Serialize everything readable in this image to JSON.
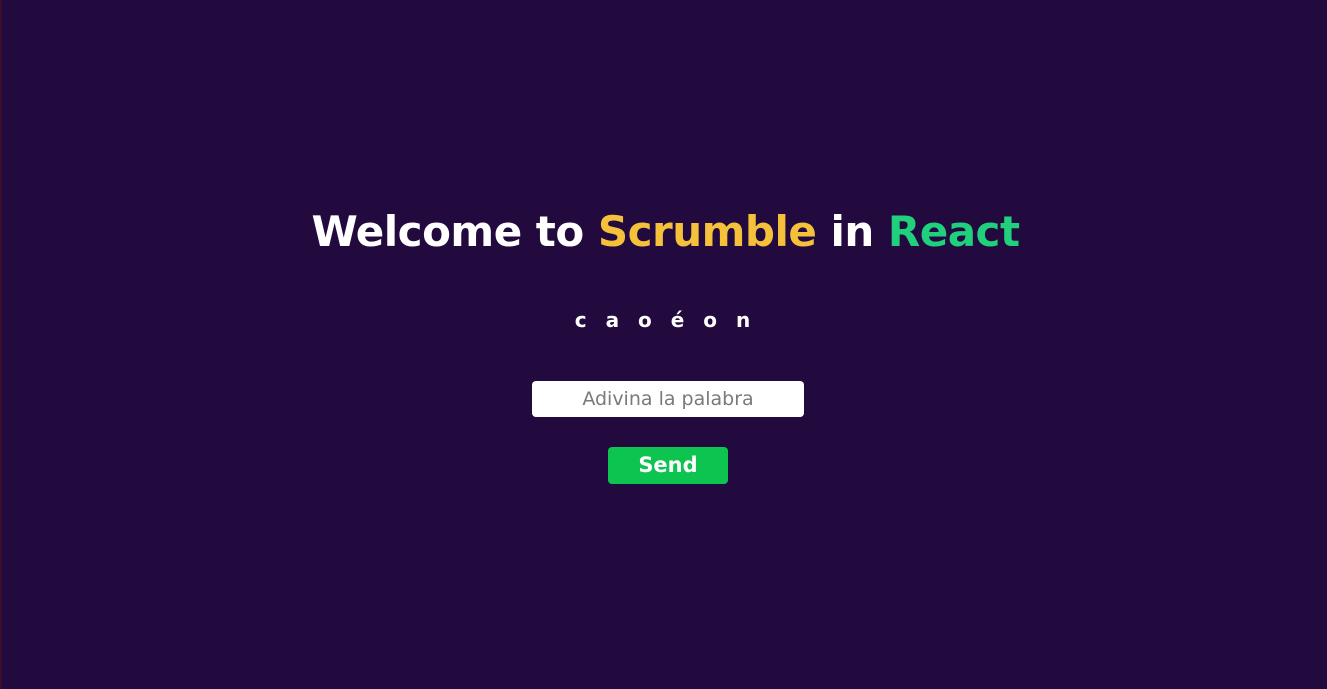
{
  "title": {
    "part1": "Welcome to ",
    "part2": "Scrumble",
    "part3": " in ",
    "part4": "React"
  },
  "game": {
    "scrambled_word": "c a o é o n",
    "input_value": "",
    "input_placeholder": "Adivina la palabra",
    "send_label": "Send"
  },
  "colors": {
    "background": "#220a3e",
    "title_text": "#ffffff",
    "accent_scrumble": "#f5c13b",
    "accent_react": "#21d07c",
    "send_button": "#0dc451"
  }
}
